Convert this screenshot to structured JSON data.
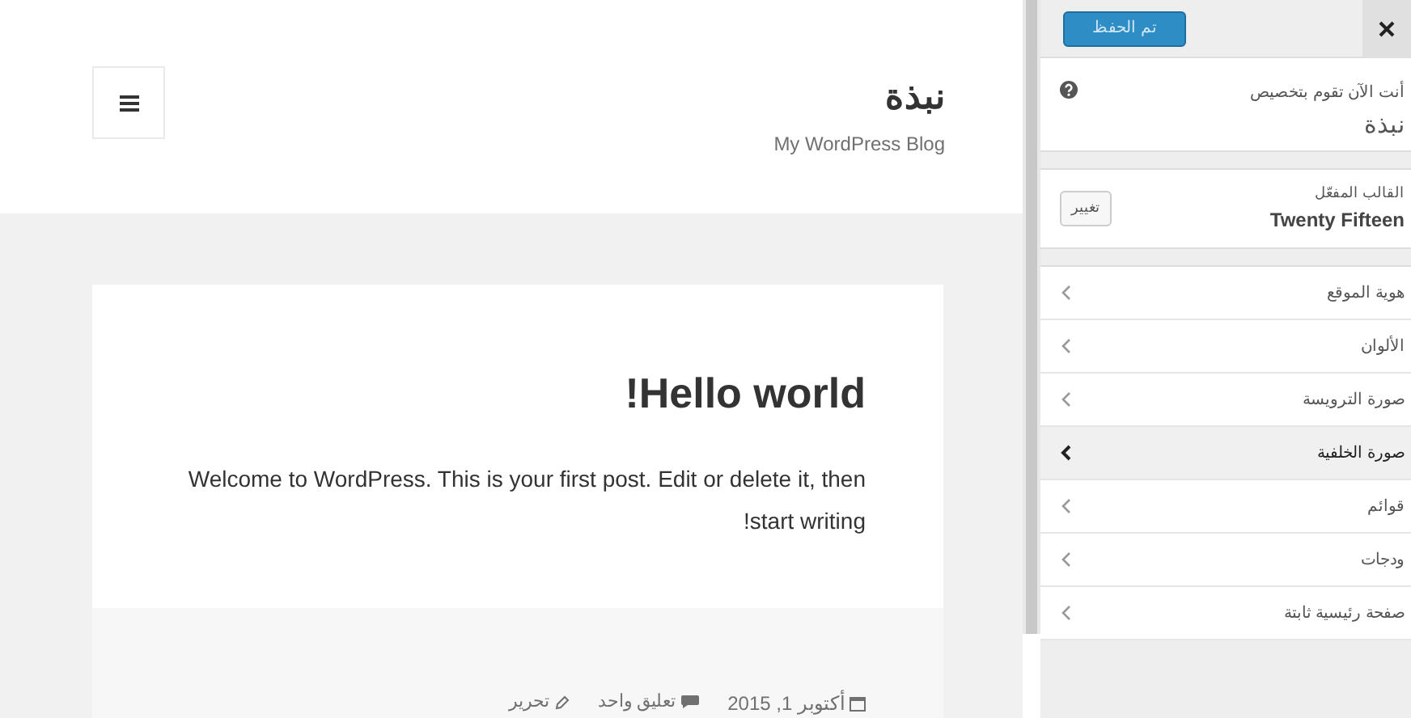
{
  "preview": {
    "site_title": "نبذة",
    "tagline": "My WordPress Blog",
    "post": {
      "title": "Hello world!",
      "body": "Welcome to WordPress. This is your first post. Edit or delete it, then start writing!",
      "date": "أكتوبر 1, 2015",
      "comments": "تعليق واحد",
      "edit": "تحرير"
    }
  },
  "customizer": {
    "save_button": "تم الحفظ",
    "intro": "أنت الآن تقوم بتخصيص",
    "site_name": "نبذة",
    "theme_label": "القالب المفعّل",
    "theme_name": "Twenty Fifteen",
    "change_button": "تغيير",
    "sections": [
      {
        "label": "هوية الموقع",
        "selected": false
      },
      {
        "label": "الألوان",
        "selected": false
      },
      {
        "label": "صورة الترويسة",
        "selected": false
      },
      {
        "label": "صورة الخلفية",
        "selected": true
      },
      {
        "label": "قوائم",
        "selected": false
      },
      {
        "label": "ودجات",
        "selected": false
      },
      {
        "label": "صفحة رئيسية ثابتة",
        "selected": false
      }
    ]
  }
}
